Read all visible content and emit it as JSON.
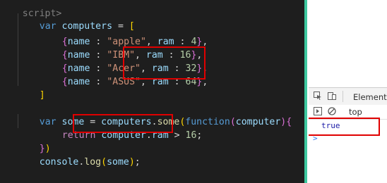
{
  "editor": {
    "lines": {
      "l0": {
        "open_tag": "script>"
      },
      "l1": {
        "kw": "var",
        "name": "computers",
        "eq": " = ",
        "open": "["
      },
      "l2": {
        "open": "{",
        "k1": "name",
        "c1": " : ",
        "v1": "\"apple\"",
        "comma1": ", ",
        "k2": "ram",
        "c2": " : ",
        "v2": "4",
        "close": "}",
        "tail": ","
      },
      "l3": {
        "open": "{",
        "k1": "name",
        "c1": " : ",
        "v1": "\"IBM\"",
        "comma1": ", ",
        "k2": "ram",
        "c2": " : ",
        "v2": "16",
        "close": "}",
        "tail": ","
      },
      "l4": {
        "open": "{",
        "k1": "name",
        "c1": " : ",
        "v1": "\"Acer\"",
        "comma1": ", ",
        "k2": "ram",
        "c2": " : ",
        "v2": "32",
        "close": "}",
        "tail": ","
      },
      "l5": {
        "open": "{",
        "k1": "name",
        "c1": " : ",
        "v1": "\"ASUS\"",
        "comma1": ", ",
        "k2": "ram",
        "c2": " : ",
        "v2": "64",
        "close": "}",
        "tail": ","
      },
      "l6": {
        "close": "]"
      },
      "l8": {
        "kw": "var",
        "name": "some",
        "eq": " = ",
        "obj": "computers",
        "dot": ".",
        "method": "some",
        "paren": "(",
        "fn": "function",
        "paren2": "(",
        "param": "computer",
        "paren3": ")",
        "brace": "{"
      },
      "l9": {
        "ret": "return",
        "obj": "computer",
        "dot": ".",
        "prop": "ram",
        "op": " > ",
        "num": "16",
        "semi": ";"
      },
      "l10": {
        "brace": "}",
        "paren": ")"
      },
      "l11": {
        "obj": "console",
        "dot": ".",
        "method": "log",
        "paren": "(",
        "arg": "some",
        "paren2": ")",
        "semi": ";"
      }
    }
  },
  "devtools": {
    "tab_elements": "Elements",
    "context": "top",
    "console_result": "true",
    "prompt": ">"
  }
}
